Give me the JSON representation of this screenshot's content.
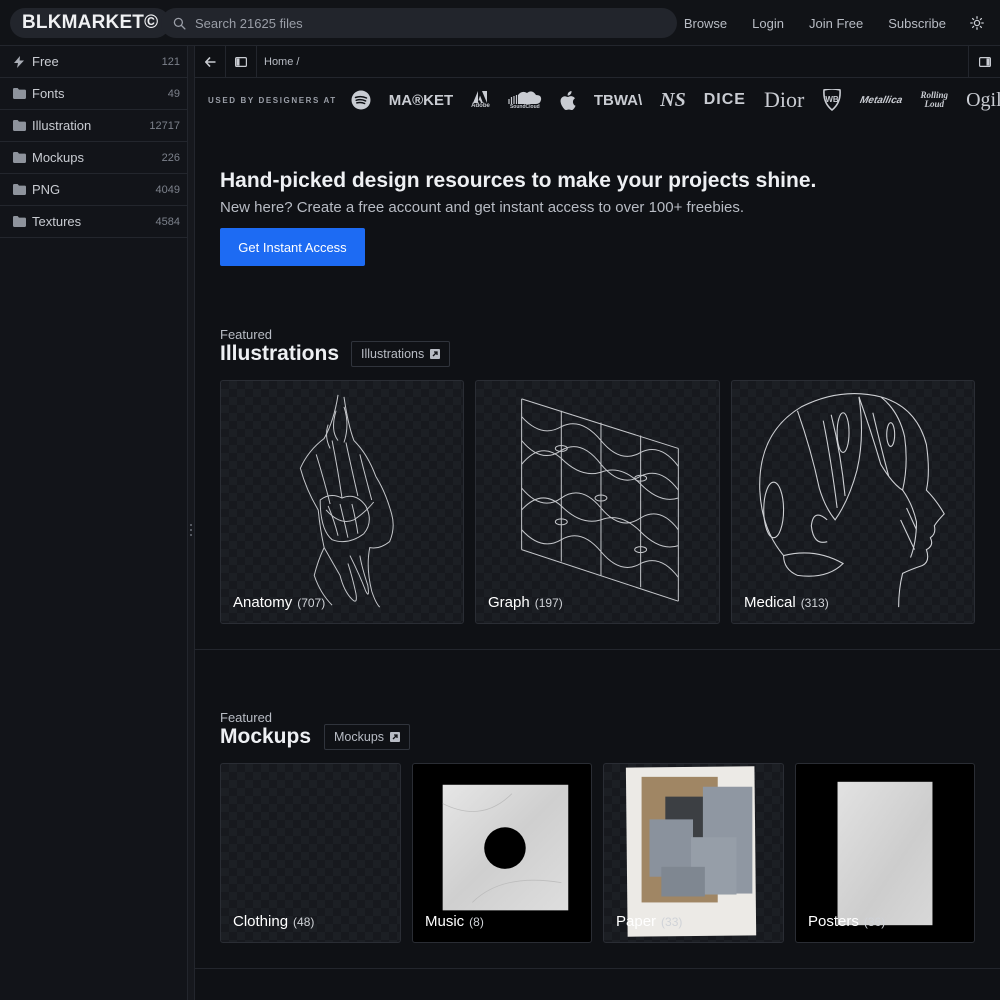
{
  "header": {
    "logo": "BLKMARKET©",
    "search_placeholder": "Search 21625 files",
    "nav": [
      "Browse",
      "Login",
      "Join Free",
      "Subscribe"
    ],
    "theme_icon": "sun-icon"
  },
  "sidebar": {
    "items": [
      {
        "label": "Free",
        "count": "121",
        "icon": "bolt-icon"
      },
      {
        "label": "Fonts",
        "count": "49",
        "icon": "folder-icon"
      },
      {
        "label": "Illustration",
        "count": "12717",
        "icon": "folder-icon"
      },
      {
        "label": "Mockups",
        "count": "226",
        "icon": "folder-icon"
      },
      {
        "label": "PNG",
        "count": "4049",
        "icon": "folder-icon"
      },
      {
        "label": "Textures",
        "count": "4584",
        "icon": "folder-icon"
      }
    ]
  },
  "toolbar": {
    "breadcrumb": "Home /"
  },
  "brands": {
    "label": "USED BY DESIGNERS AT",
    "logos": [
      "MA®KET",
      "Adobe",
      "SoundCloud",
      "TBWA\\",
      "NS",
      "DICE",
      "Dior",
      "WB",
      "Metallica",
      "Rolling Loud",
      "Ogilvy"
    ]
  },
  "hero": {
    "title": "Hand-picked design resources to make your projects shine.",
    "subtitle": "New here? Create a free account and get instant access to over 100+ freebies.",
    "cta": "Get Instant Access"
  },
  "sections": [
    {
      "eyebrow": "Featured",
      "title": "Illustrations",
      "link": "Illustrations",
      "cards": [
        {
          "name": "Anatomy",
          "count": "(707)"
        },
        {
          "name": "Graph",
          "count": "(197)"
        },
        {
          "name": "Medical",
          "count": "(313)"
        }
      ]
    },
    {
      "eyebrow": "Featured",
      "title": "Mockups",
      "link": "Mockups",
      "cards": [
        {
          "name": "Clothing",
          "count": "(48)"
        },
        {
          "name": "Music",
          "count": "(8)"
        },
        {
          "name": "Paper",
          "count": "(33)"
        },
        {
          "name": "Posters",
          "count": "(36)"
        }
      ]
    }
  ],
  "colors": {
    "accent": "#1d6bf3",
    "background": "#0f1115",
    "sidebar": "#121419"
  }
}
